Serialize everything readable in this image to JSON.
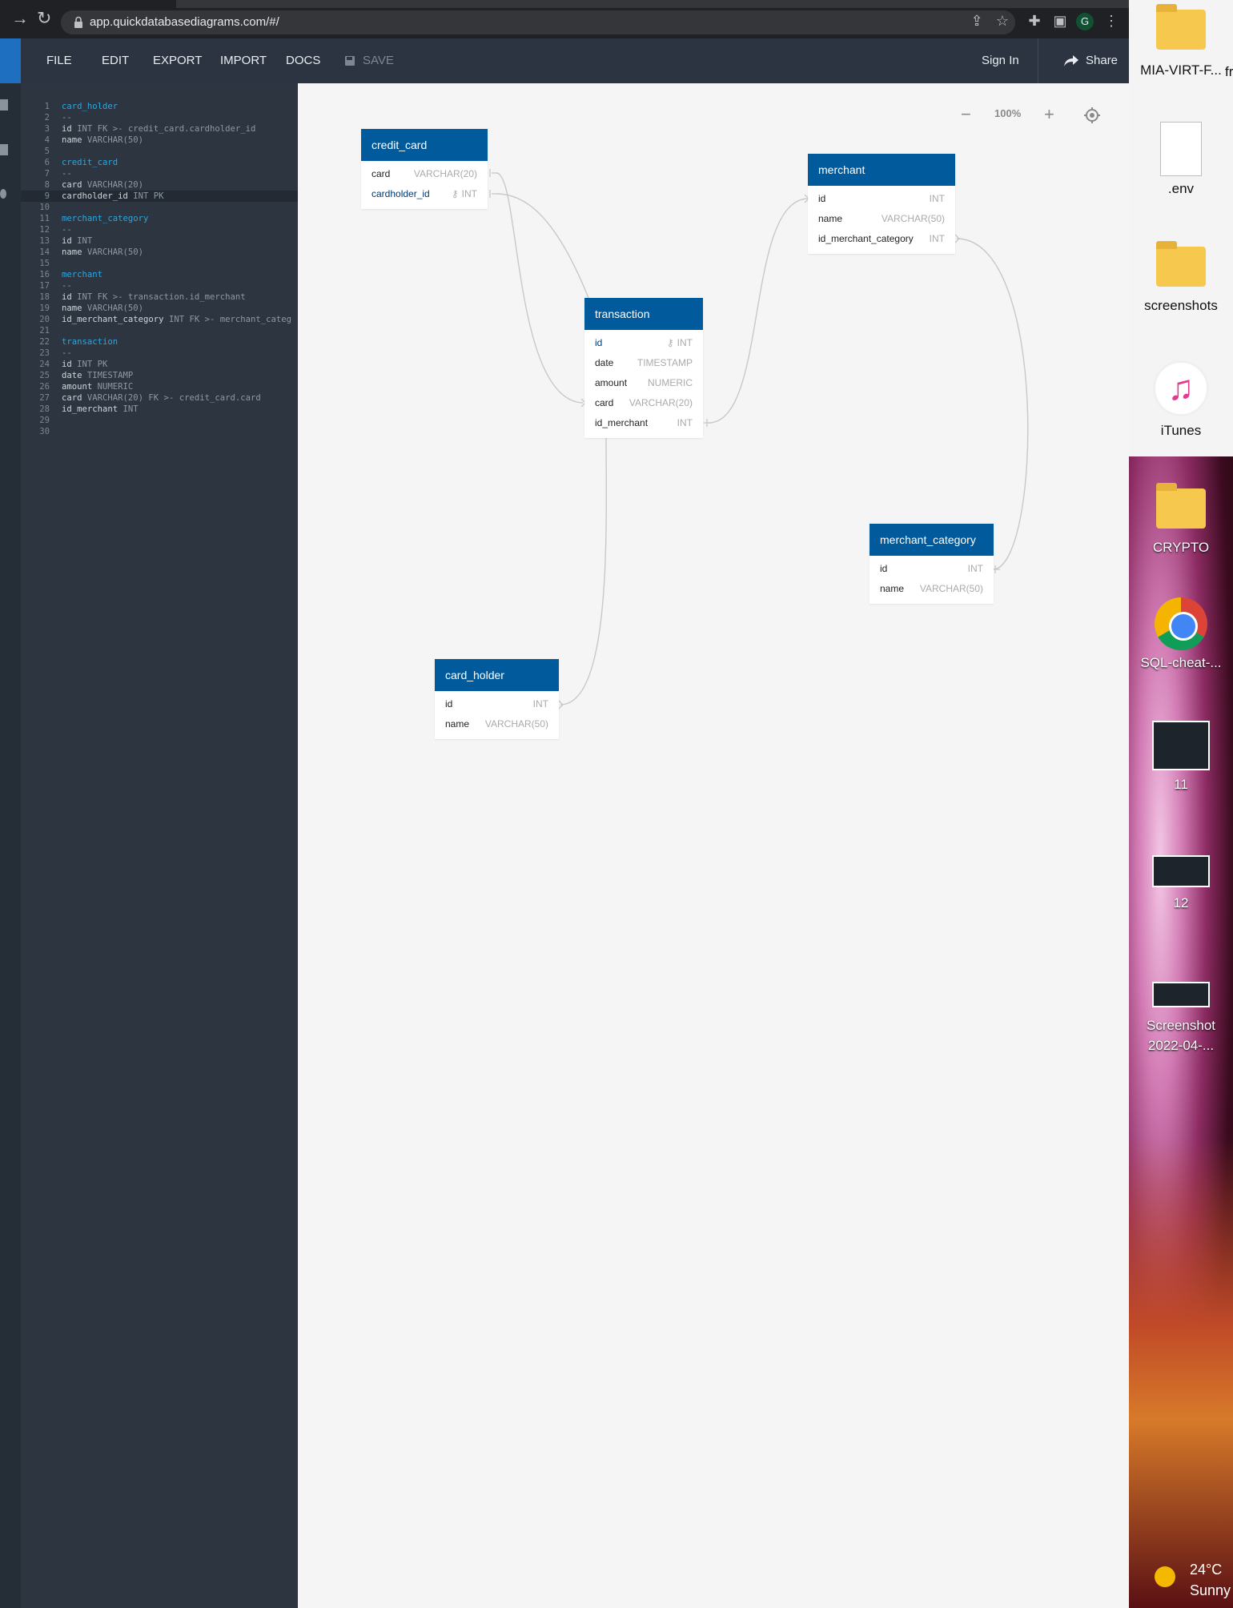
{
  "browser": {
    "url": "app.quickdatabasediagrams.com/#/",
    "profile_initial": "G"
  },
  "toolbar": {
    "menu": [
      "FILE",
      "EDIT",
      "EXPORT",
      "IMPORT",
      "DOCS"
    ],
    "save_label": "SAVE",
    "signin_label": "Sign In",
    "share_label": "Share"
  },
  "editor": {
    "lines": [
      {
        "n": "1",
        "segs": [
          {
            "t": "card_holder",
            "c": "tbl-name"
          }
        ]
      },
      {
        "n": "2",
        "segs": [
          {
            "t": "--",
            "c": "dim"
          }
        ]
      },
      {
        "n": "3",
        "segs": [
          {
            "t": "id ",
            "c": ""
          },
          {
            "t": "INT FK >- credit_card.cardholder_id",
            "c": "dim"
          }
        ]
      },
      {
        "n": "4",
        "segs": [
          {
            "t": "name ",
            "c": ""
          },
          {
            "t": "VARCHAR(50)",
            "c": "dim"
          }
        ]
      },
      {
        "n": "5",
        "segs": []
      },
      {
        "n": "6",
        "segs": [
          {
            "t": "credit_card",
            "c": "tbl-name"
          }
        ]
      },
      {
        "n": "7",
        "segs": [
          {
            "t": "--",
            "c": "dim"
          }
        ]
      },
      {
        "n": "8",
        "segs": [
          {
            "t": "card ",
            "c": ""
          },
          {
            "t": "VARCHAR(20)",
            "c": "dim"
          }
        ]
      },
      {
        "n": "9",
        "segs": [
          {
            "t": "cardholder_id ",
            "c": ""
          },
          {
            "t": "INT PK",
            "c": "dim"
          }
        ],
        "active": true
      },
      {
        "n": "10",
        "segs": []
      },
      {
        "n": "11",
        "segs": [
          {
            "t": "merchant_category",
            "c": "tbl-name"
          }
        ]
      },
      {
        "n": "12",
        "segs": [
          {
            "t": "--",
            "c": "dim"
          }
        ]
      },
      {
        "n": "13",
        "segs": [
          {
            "t": "id ",
            "c": ""
          },
          {
            "t": "INT",
            "c": "dim"
          }
        ]
      },
      {
        "n": "14",
        "segs": [
          {
            "t": "name ",
            "c": ""
          },
          {
            "t": "VARCHAR(50)",
            "c": "dim"
          }
        ]
      },
      {
        "n": "15",
        "segs": []
      },
      {
        "n": "16",
        "segs": [
          {
            "t": "merchant",
            "c": "tbl-name"
          }
        ]
      },
      {
        "n": "17",
        "segs": [
          {
            "t": "--",
            "c": "dim"
          }
        ]
      },
      {
        "n": "18",
        "segs": [
          {
            "t": "id ",
            "c": ""
          },
          {
            "t": "INT FK >- transaction.id_merchant",
            "c": "dim"
          }
        ]
      },
      {
        "n": "19",
        "segs": [
          {
            "t": "name ",
            "c": ""
          },
          {
            "t": "VARCHAR(50)",
            "c": "dim"
          }
        ]
      },
      {
        "n": "20",
        "segs": [
          {
            "t": "id_merchant_category ",
            "c": ""
          },
          {
            "t": "INT FK >- merchant_categ",
            "c": "dim"
          }
        ]
      },
      {
        "n": "21",
        "segs": []
      },
      {
        "n": "22",
        "segs": [
          {
            "t": "transaction",
            "c": "tbl-name"
          }
        ]
      },
      {
        "n": "23",
        "segs": [
          {
            "t": "--",
            "c": "dim"
          }
        ]
      },
      {
        "n": "24",
        "segs": [
          {
            "t": "id ",
            "c": ""
          },
          {
            "t": "INT PK",
            "c": "dim"
          }
        ]
      },
      {
        "n": "25",
        "segs": [
          {
            "t": "date ",
            "c": ""
          },
          {
            "t": "TIMESTAMP",
            "c": "dim"
          }
        ]
      },
      {
        "n": "26",
        "segs": [
          {
            "t": "amount ",
            "c": ""
          },
          {
            "t": "NUMERIC",
            "c": "dim"
          }
        ]
      },
      {
        "n": "27",
        "segs": [
          {
            "t": "card ",
            "c": ""
          },
          {
            "t": "VARCHAR(20) FK >- credit_card.card",
            "c": "dim"
          }
        ]
      },
      {
        "n": "28",
        "segs": [
          {
            "t": "id_merchant ",
            "c": ""
          },
          {
            "t": "INT",
            "c": "dim"
          }
        ]
      },
      {
        "n": "29",
        "segs": []
      },
      {
        "n": "30",
        "segs": []
      }
    ]
  },
  "canvas": {
    "zoom_label": "100%"
  },
  "tables": {
    "credit_card": {
      "name": "credit_card",
      "cols": [
        {
          "name": "card",
          "type": "VARCHAR(20)",
          "pk": false
        },
        {
          "name": "cardholder_id",
          "type": "INT",
          "pk": true
        }
      ]
    },
    "merchant": {
      "name": "merchant",
      "cols": [
        {
          "name": "id",
          "type": "INT",
          "pk": false
        },
        {
          "name": "name",
          "type": "VARCHAR(50)",
          "pk": false
        },
        {
          "name": "id_merchant_category",
          "type": "INT",
          "pk": false
        }
      ]
    },
    "transaction": {
      "name": "transaction",
      "cols": [
        {
          "name": "id",
          "type": "INT",
          "pk": true
        },
        {
          "name": "date",
          "type": "TIMESTAMP",
          "pk": false
        },
        {
          "name": "amount",
          "type": "NUMERIC",
          "pk": false
        },
        {
          "name": "card",
          "type": "VARCHAR(20)",
          "pk": false
        },
        {
          "name": "id_merchant",
          "type": "INT",
          "pk": false
        }
      ]
    },
    "merchant_category": {
      "name": "merchant_category",
      "cols": [
        {
          "name": "id",
          "type": "INT",
          "pk": false
        },
        {
          "name": "name",
          "type": "VARCHAR(50)",
          "pk": false
        }
      ]
    },
    "card_holder": {
      "name": "card_holder",
      "cols": [
        {
          "name": "id",
          "type": "INT",
          "pk": false
        },
        {
          "name": "name",
          "type": "VARCHAR(50)",
          "pk": false
        }
      ]
    }
  },
  "desktop": {
    "icons": [
      "MIA-VIRT-F...",
      ".env",
      "screenshots",
      "iTunes",
      "CRYPTO",
      "SQL-cheat-...",
      "11",
      "12",
      "Screenshot 2022-04-..."
    ],
    "cut_label": "fr",
    "weather_temp": "24°C",
    "weather_text": "Sunny"
  },
  "colors": {
    "table_header": "#005a9c",
    "canvas_bg": "#f5f5f5",
    "editor_bg": "#2c3540",
    "table_name_code": "#2ea6e0"
  }
}
